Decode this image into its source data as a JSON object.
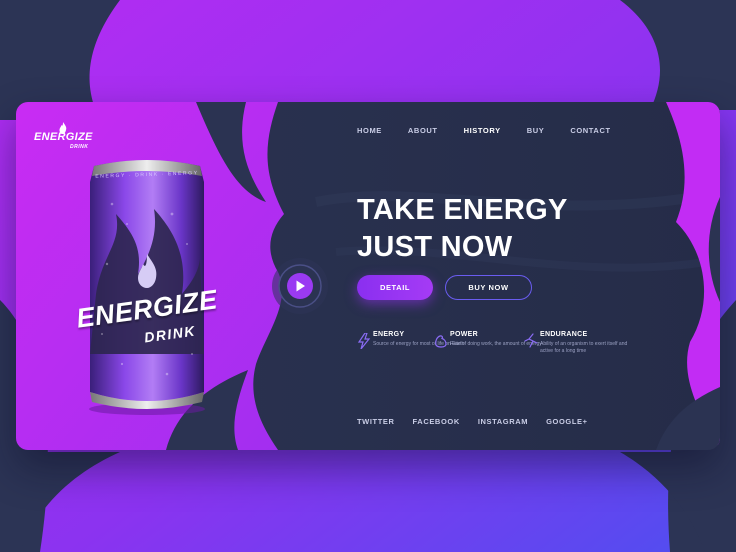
{
  "brand": {
    "logo_word": "ENERGIZE",
    "logo_sub": "DRINK",
    "can_word": "ENERGIZE",
    "can_sub": "DRINK",
    "can_top": "ENERGY · DRINK · ENERGY"
  },
  "nav": {
    "items": [
      {
        "label": "HOME",
        "active": false
      },
      {
        "label": "ABOUT",
        "active": false
      },
      {
        "label": "HISTORY",
        "active": true
      },
      {
        "label": "BUY",
        "active": false
      },
      {
        "label": "CONTACT",
        "active": false
      }
    ]
  },
  "hero": {
    "line1": "TAKE ENERGY",
    "line2": "JUST NOW",
    "detail_label": "DETAIL",
    "buy_label": "BUY NOW"
  },
  "features": [
    {
      "icon": "lightning-icon",
      "title": "ENERGY",
      "desc": "Source of energy for most of life on Earth"
    },
    {
      "icon": "muscle-icon",
      "title": "POWER",
      "desc": "Rate of doing work, the amount of energy"
    },
    {
      "icon": "runner-icon",
      "title": "ENDURANCE",
      "desc": "Ability of an organism to exert itself and active for a long time"
    }
  ],
  "social": {
    "items": [
      "TWITTER",
      "FACEBOOK",
      "INSTAGRAM",
      "GOOGLE+"
    ]
  },
  "colors": {
    "accent": "#a53bf5",
    "magenta": "#c22cf4",
    "navy": "#2a3350",
    "outline": "#6a5cf0"
  }
}
